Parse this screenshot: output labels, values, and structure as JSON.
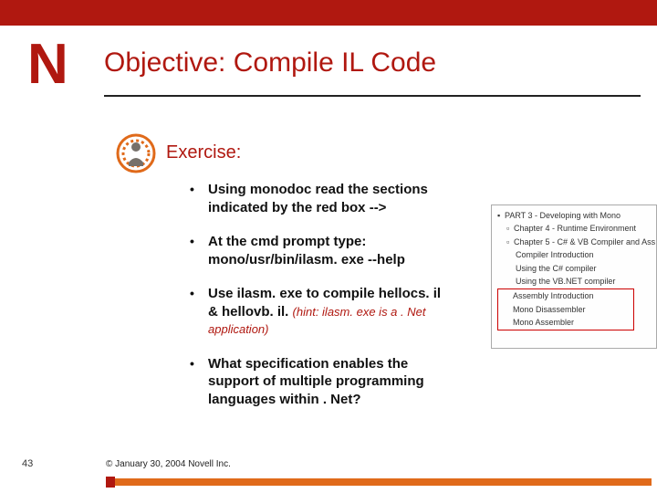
{
  "logo_letter": "N",
  "title": "Objective: Compile IL Code",
  "exercise_label": "Exercise:",
  "bullets": [
    {
      "text": "Using monodoc read the sections indicated by the red box -->"
    },
    {
      "text": "At the cmd prompt type: mono/usr/bin/ilasm. exe --help"
    },
    {
      "text": "Use ilasm. exe to compile hellocs. il & hellovb. il.",
      "hint": "(hint: ilasm. exe is a . Net application)"
    },
    {
      "text": "What specification enables the support of multiple programming languages within . Net?"
    }
  ],
  "toc": {
    "lines": [
      "PART 3 - Developing with Mono",
      "Chapter 4 - Runtime Environment",
      "Chapter 5 - C# & VB Compiler and Ass",
      "Compiler Introduction",
      "Using the C# compiler",
      "Using the VB.NET compiler"
    ],
    "highlight": [
      "Assembly Introduction",
      "Mono Disassembler",
      "Mono Assembler"
    ]
  },
  "footer": {
    "page": "43",
    "copyright": "© January 30, 2004 Novell Inc."
  }
}
